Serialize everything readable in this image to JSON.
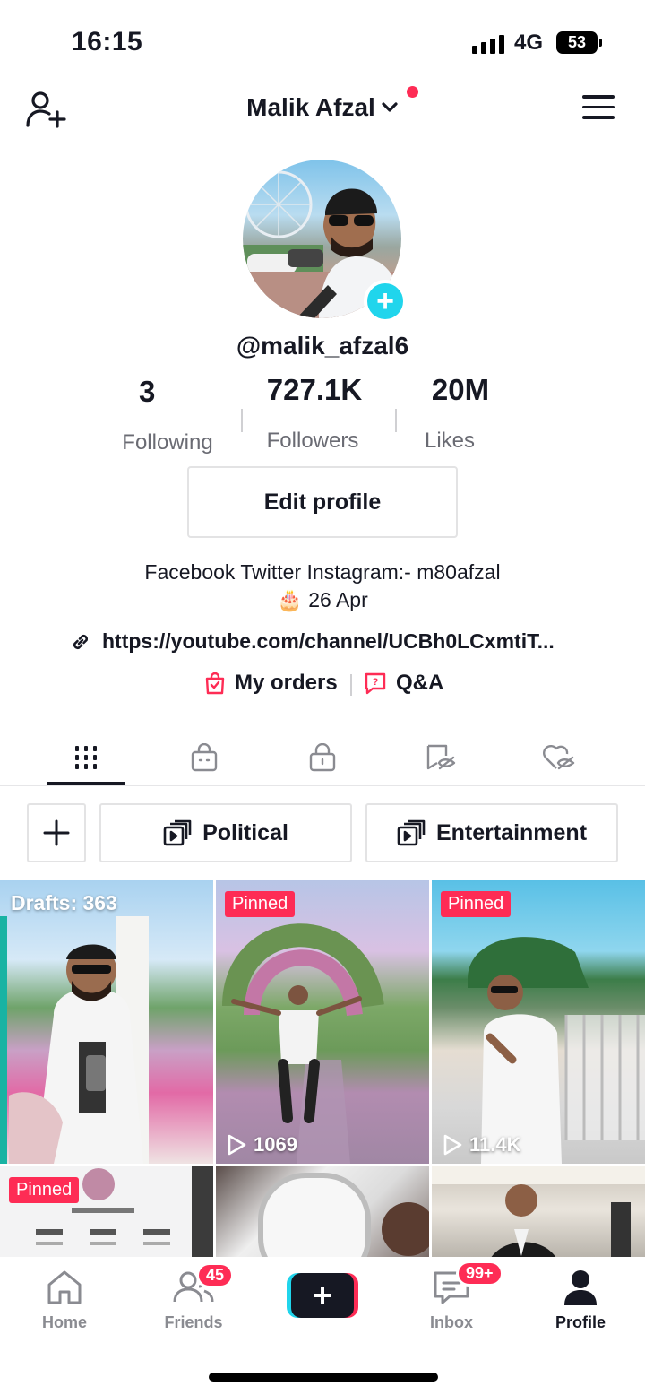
{
  "status_bar": {
    "time": "16:15",
    "network": "4G",
    "battery": "53"
  },
  "header": {
    "username": "Malik Afzal"
  },
  "profile": {
    "handle": "@malik_afzal6",
    "stats": [
      {
        "value": "3",
        "label": "Following"
      },
      {
        "value": "727.1K",
        "label": "Followers"
      },
      {
        "value": "20M",
        "label": "Likes"
      }
    ],
    "edit_label": "Edit profile",
    "bio_line1": "Facebook Twitter Instagram:- m80afzal",
    "bio_line2": "🎂 26 Apr",
    "link": "https://youtube.com/channel/UCBh0LCxmtiT...",
    "orders_label": "My orders",
    "qa_label": "Q&A"
  },
  "playlists": [
    {
      "label": "Political"
    },
    {
      "label": "Entertainment"
    }
  ],
  "videos": [
    {
      "overlay": "Drafts: 363"
    },
    {
      "tag": "Pinned",
      "views": "1069"
    },
    {
      "tag": "Pinned",
      "views": "11.4K"
    },
    {
      "tag": "Pinned"
    },
    {},
    {}
  ],
  "nav": {
    "home": "Home",
    "friends": "Friends",
    "friends_badge": "45",
    "inbox": "Inbox",
    "inbox_badge": "99+",
    "profile": "Profile"
  },
  "colors": {
    "accent": "#fe2c55",
    "cyan": "#20d5ec",
    "text": "#161823"
  }
}
